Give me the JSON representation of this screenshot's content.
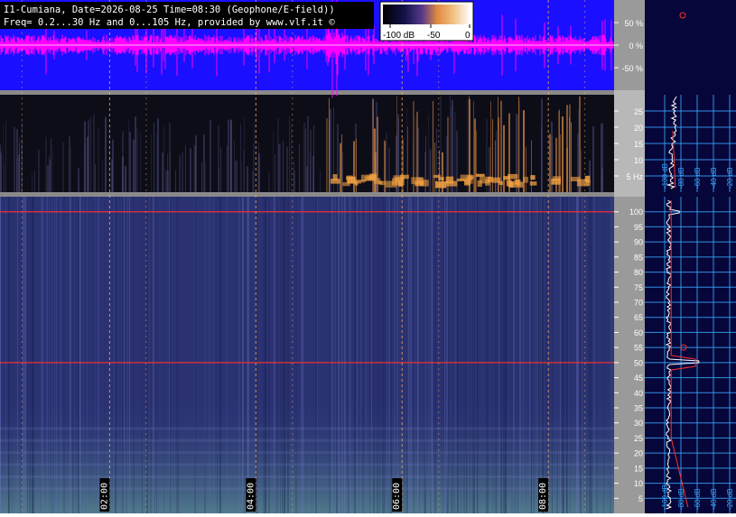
{
  "header": {
    "line1": "I1-Cumiana, Date=2026-08-25 Time=08:30 (Geophone/E-field))",
    "line2": "Freq= 0.2...30 Hz and 0...105 Hz, provided by www.vlf.it ©"
  },
  "colors": {
    "waveform_bg": "#1a10ff",
    "waveform_trace": "#ff00ff",
    "spectrogram_bg": "#22295c",
    "spectrum_panel_bg": "#06063a",
    "axis_panel_bg": "#8a8a8a",
    "grid_line": "#3aa8ff",
    "marker_red": "#ff3030",
    "time_marker": "#ffb060"
  },
  "chart_data": [
    {
      "type": "line",
      "name_id": "waveform",
      "ylim": [
        -100,
        100
      ],
      "y_ticks": [
        "50 %",
        "0 %",
        "-50 %"
      ],
      "y_tick_values": [
        50,
        0,
        -50
      ],
      "grid": false
    },
    {
      "type": "heatmap",
      "name_id": "colorbar",
      "tick_labels": [
        "-100 dB",
        "-50",
        "0"
      ],
      "range_db": [
        -100,
        0
      ]
    },
    {
      "type": "heatmap",
      "name_id": "geophone-spectrogram",
      "ylim": [
        0,
        30
      ],
      "y_ticks": [
        "25",
        "20",
        "15",
        "10",
        "5 Hz"
      ],
      "y_tick_values": [
        25,
        20,
        15,
        10,
        5
      ],
      "grid": false
    },
    {
      "type": "heatmap",
      "name_id": "efield-spectrogram",
      "ylim": [
        0,
        105
      ],
      "y_ticks": [
        "100",
        "95",
        "90",
        "85",
        "80",
        "75",
        "70",
        "65",
        "60",
        "55",
        "50",
        "45",
        "40",
        "35",
        "30",
        "25",
        "20",
        "15",
        "10",
        "5"
      ],
      "y_tick_values": [
        100,
        95,
        90,
        85,
        80,
        75,
        70,
        65,
        60,
        55,
        50,
        45,
        40,
        35,
        30,
        25,
        20,
        15,
        10,
        5
      ],
      "time_labels": [
        "02:00",
        "04:00",
        "06:00",
        "08:00"
      ],
      "time_values": [
        2,
        4,
        6,
        8
      ],
      "xlim_hours": [
        0.5,
        8.9
      ],
      "horizontal_lines_hz": [
        50,
        100
      ],
      "grid": false
    },
    {
      "type": "line",
      "name_id": "geophone-spectrum",
      "x_ticks": [
        "-100 dB",
        "-80 dB",
        "-60 dB",
        "-40 dB",
        "-20 dB"
      ],
      "x_tick_values": [
        -100,
        -80,
        -60,
        -40,
        -20
      ],
      "grid": true
    },
    {
      "type": "line",
      "name_id": "efield-spectrum",
      "x_ticks": [
        "-100 dB",
        "-80 dB",
        "-60 dB",
        "-40 dB",
        "-20 dB"
      ],
      "x_tick_values": [
        -100,
        -80,
        -60,
        -40,
        -20
      ],
      "grid": true
    }
  ]
}
